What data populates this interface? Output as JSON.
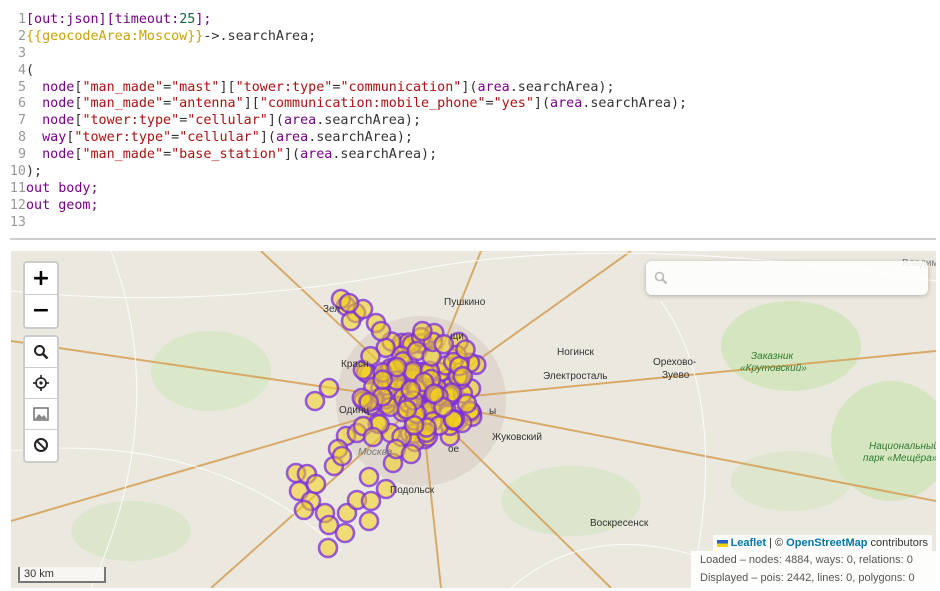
{
  "editor": {
    "lines": [
      {
        "n": "1",
        "t": [
          [
            "kw",
            "[out:json][timeout:"
          ],
          [
            "num",
            "25"
          ],
          [
            "kw",
            "];"
          ]
        ]
      },
      {
        "n": "2",
        "t": [
          [
            "tpl",
            "{{geocodeArea:Moscow}}"
          ],
          [
            "pl",
            "->.searchArea;"
          ]
        ]
      },
      {
        "n": "3",
        "t": []
      },
      {
        "n": "4",
        "t": [
          [
            "pl",
            "("
          ]
        ]
      },
      {
        "n": "5",
        "t": [
          [
            "pl",
            "  "
          ],
          [
            "kw",
            "node"
          ],
          [
            "pl",
            "["
          ],
          [
            "str",
            "\"man_made\""
          ],
          [
            "pl",
            "="
          ],
          [
            "str",
            "\"mast\""
          ],
          [
            "pl",
            "]["
          ],
          [
            "str",
            "\"tower:type\""
          ],
          [
            "pl",
            "="
          ],
          [
            "str",
            "\"communication\""
          ],
          [
            "pl",
            "]("
          ],
          [
            "kw",
            "area"
          ],
          [
            "pl",
            ".searchArea);"
          ]
        ]
      },
      {
        "n": "6",
        "t": [
          [
            "pl",
            "  "
          ],
          [
            "kw",
            "node"
          ],
          [
            "pl",
            "["
          ],
          [
            "str",
            "\"man_made\""
          ],
          [
            "pl",
            "="
          ],
          [
            "str",
            "\"antenna\""
          ],
          [
            "pl",
            "]["
          ],
          [
            "str",
            "\"communication:mobile_phone\""
          ],
          [
            "pl",
            "="
          ],
          [
            "str",
            "\"yes\""
          ],
          [
            "pl",
            "]("
          ],
          [
            "kw",
            "area"
          ],
          [
            "pl",
            ".searchArea);"
          ]
        ]
      },
      {
        "n": "7",
        "t": [
          [
            "pl",
            "  "
          ],
          [
            "kw",
            "node"
          ],
          [
            "pl",
            "["
          ],
          [
            "str",
            "\"tower:type\""
          ],
          [
            "pl",
            "="
          ],
          [
            "str",
            "\"cellular\""
          ],
          [
            "pl",
            "]("
          ],
          [
            "kw",
            "area"
          ],
          [
            "pl",
            ".searchArea);"
          ]
        ]
      },
      {
        "n": "8",
        "t": [
          [
            "pl",
            "  "
          ],
          [
            "kw",
            "way"
          ],
          [
            "pl",
            "["
          ],
          [
            "str",
            "\"tower:type\""
          ],
          [
            "pl",
            "="
          ],
          [
            "str",
            "\"cellular\""
          ],
          [
            "pl",
            "]("
          ],
          [
            "kw",
            "area"
          ],
          [
            "pl",
            ".searchArea);"
          ]
        ]
      },
      {
        "n": "9",
        "t": [
          [
            "pl",
            "  "
          ],
          [
            "kw",
            "node"
          ],
          [
            "pl",
            "["
          ],
          [
            "str",
            "\"man_made\""
          ],
          [
            "pl",
            "="
          ],
          [
            "str",
            "\"base_station\""
          ],
          [
            "pl",
            "]("
          ],
          [
            "kw",
            "area"
          ],
          [
            "pl",
            ".searchArea);"
          ]
        ]
      },
      {
        "n": "10",
        "t": [
          [
            "pl",
            ");"
          ]
        ]
      },
      {
        "n": "11",
        "t": [
          [
            "kw",
            "out body;"
          ]
        ]
      },
      {
        "n": "12",
        "t": [
          [
            "kw",
            "out geom;"
          ]
        ]
      },
      {
        "n": "13",
        "t": []
      }
    ]
  },
  "map": {
    "zoom_in": "+",
    "zoom_out": "−",
    "search_placeholder": "",
    "tools": [
      "search-icon",
      "crosshair-icon",
      "image-icon",
      "no-icon"
    ],
    "places": [
      {
        "name": "Пушкино"
      },
      {
        "name": "Ногинск"
      },
      {
        "name": "Орехово-"
      },
      {
        "name": "Зуево"
      },
      {
        "name": "Электросталь"
      },
      {
        "name": "Жуковский"
      },
      {
        "name": "Подольск"
      },
      {
        "name": "Воскресенск"
      },
      {
        "name": "Красн"
      },
      {
        "name": "Одинц"
      },
      {
        "name": "Москва"
      },
      {
        "name": "Владим"
      },
      {
        "name": "Заказник"
      },
      {
        "name": "«Крутовский»"
      },
      {
        "name": "Национальный"
      },
      {
        "name": "парк «Мещёра»"
      },
      {
        "name": "Зел"
      },
      {
        "name": "щи"
      },
      {
        "name": "ое"
      },
      {
        "name": "ы"
      }
    ],
    "scale_label": "30 km",
    "attribution": {
      "leaflet": "Leaflet",
      "sep": " | © ",
      "osm": "OpenStreetMap",
      "suffix": " contributors"
    },
    "stats": {
      "loaded": "Loaded – nodes: 4884, ways: 0, relations: 0",
      "displayed": "Displayed – pois: 2442, lines: 0, polygons: 0"
    },
    "colors": {
      "marker_stroke": "#7a2be0",
      "marker_fill": "#f2d21b",
      "road": "#ffffff",
      "major_road": "#d6a35c"
    }
  }
}
